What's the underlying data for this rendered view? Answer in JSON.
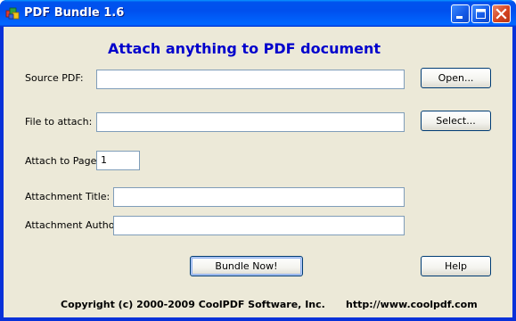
{
  "window": {
    "title": "PDF Bundle 1.6"
  },
  "main": {
    "heading": "Attach anything to PDF document",
    "source_pdf": {
      "label": "Source PDF:",
      "value": "",
      "button": "Open..."
    },
    "file_to_attach": {
      "label": "File to attach:",
      "value": "",
      "button": "Select..."
    },
    "attach_to_page": {
      "label": "Attach to Page",
      "value": "1"
    },
    "attachment_title": {
      "label": "Attachment Title:",
      "value": ""
    },
    "attachment_author": {
      "label": "Attachment Author:",
      "value": ""
    },
    "bundle_button": "Bundle Now!",
    "help_button": "Help"
  },
  "footer": {
    "copyright": "Copyright (c) 2000-2009 CoolPDF Software, Inc.",
    "url": "http://www.coolpdf.com"
  },
  "colors": {
    "heading": "#0000cc",
    "client_background": "#ece9d8",
    "titlebar": "#0054e3"
  }
}
